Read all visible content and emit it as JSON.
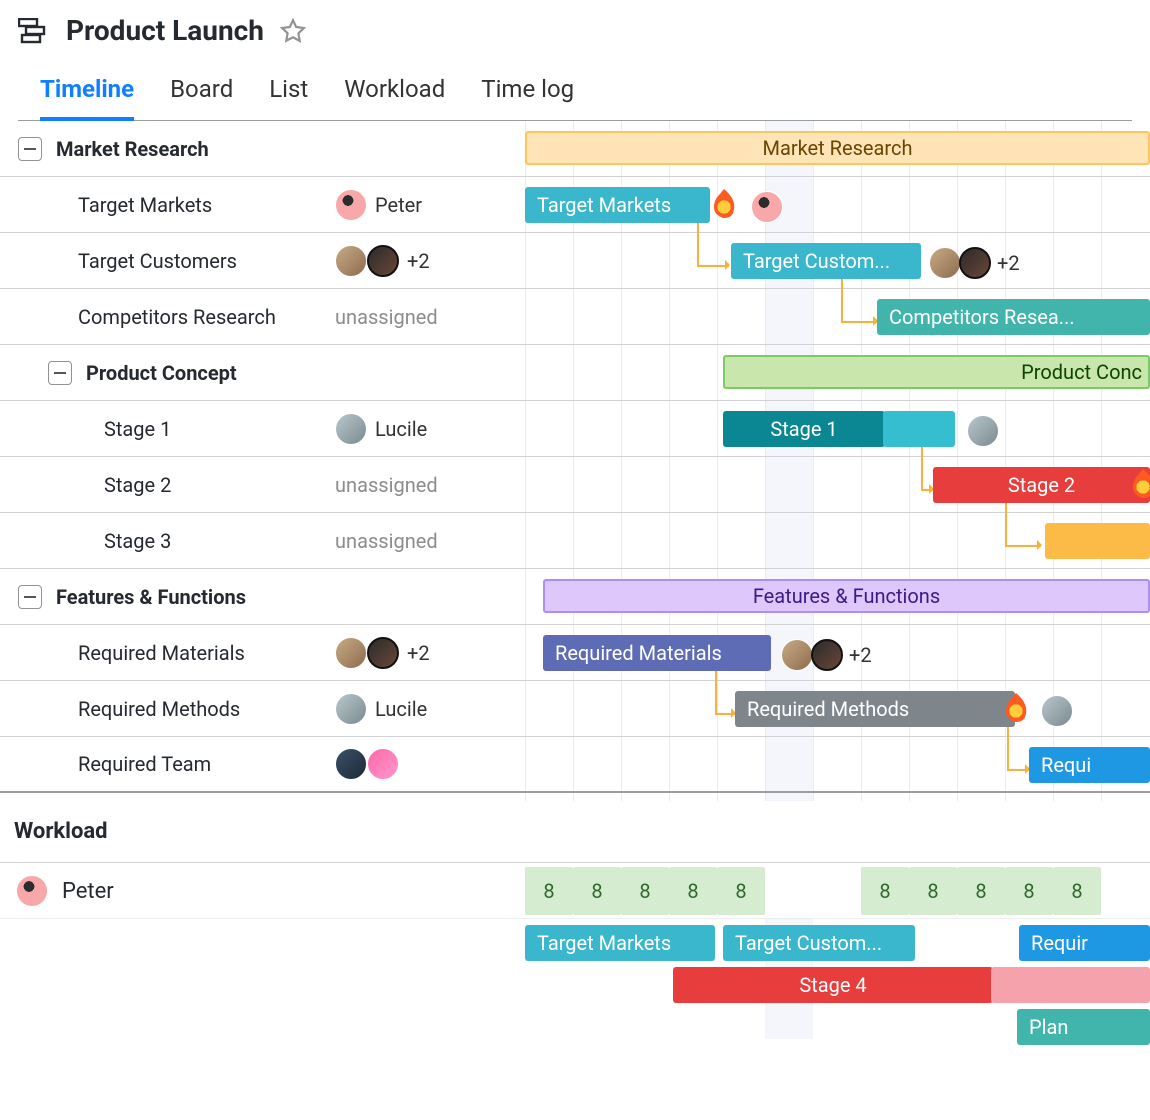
{
  "header": {
    "title": "Product Launch"
  },
  "tabs": [
    "Timeline",
    "Board",
    "List",
    "Workload",
    "Time log"
  ],
  "activeTab": 0,
  "groups": [
    {
      "name": "Market Research",
      "color": "orange",
      "tasks": [
        {
          "name": "Target Markets",
          "assignees": [
            "Peter"
          ],
          "assigneeLabel": "Peter",
          "barColor": "cyan",
          "hot": true
        },
        {
          "name": "Target Customers",
          "assignees": [
            "a",
            "b"
          ],
          "extra": "+2",
          "barLabel": "Target Custom...",
          "barColor": "cyan"
        },
        {
          "name": "Competitors Research",
          "assigneeLabel": "unassigned",
          "barLabel": "Competitors Resea...",
          "barColor": "cyan-d"
        }
      ],
      "subgroup": {
        "name": "Product Concept",
        "color": "green",
        "barLabel": "Product Conc",
        "tasks": [
          {
            "name": "Stage 1",
            "assignees": [
              "Lucile"
            ],
            "assigneeLabel": "Lucile",
            "barColor": "teal"
          },
          {
            "name": "Stage 2",
            "assigneeLabel": "unassigned",
            "barColor": "red",
            "hot": true
          },
          {
            "name": "Stage 3",
            "assigneeLabel": "unassigned",
            "barColor": "orange"
          }
        ]
      }
    },
    {
      "name": "Features & Functions",
      "color": "purple",
      "tasks": [
        {
          "name": "Required Materials",
          "assignees": [
            "a",
            "b"
          ],
          "extra": "+2",
          "barColor": "indigo"
        },
        {
          "name": "Required Methods",
          "assignees": [
            "Lucile"
          ],
          "assigneeLabel": "Lucile",
          "barColor": "gray",
          "hot": true
        },
        {
          "name": "Required Team",
          "assignees": [
            "c",
            "d"
          ],
          "barLabel": "Requi",
          "barColor": "blue"
        }
      ]
    }
  ],
  "workload": {
    "title": "Workload",
    "person": {
      "name": "Peter",
      "avatar": "peter"
    },
    "hours": [
      "8",
      "8",
      "8",
      "8",
      "8",
      "",
      "",
      "8",
      "8",
      "8",
      "8",
      "8"
    ],
    "bars": [
      {
        "label": "Target Markets",
        "color": "cyan"
      },
      {
        "label": "Target Custom...",
        "color": "cyan"
      },
      {
        "label": "Requir",
        "color": "blue"
      },
      {
        "label": "Stage 4",
        "color": "red-pink"
      },
      {
        "label": "Plan",
        "color": "teal"
      }
    ]
  }
}
